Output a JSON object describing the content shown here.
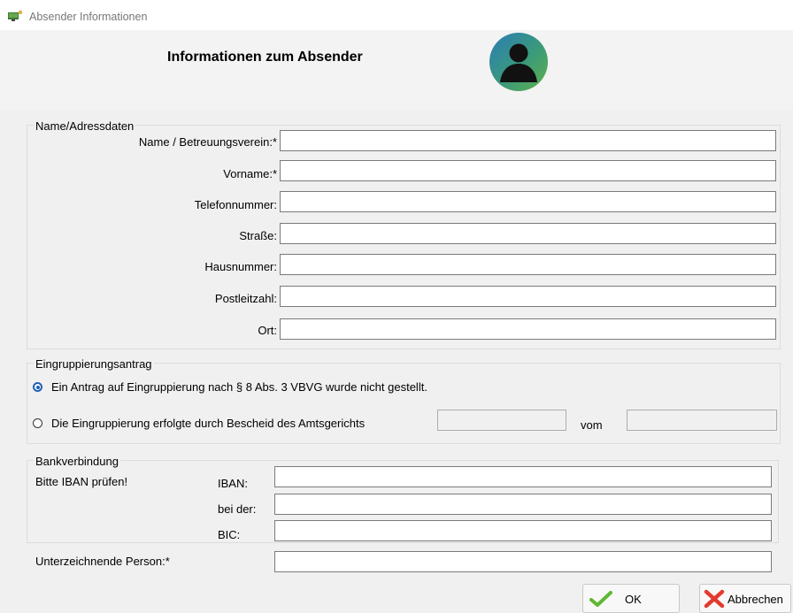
{
  "window": {
    "title": "Absender Informationen"
  },
  "header": {
    "heading": "Informationen zum Absender",
    "avatar_icon": "user-avatar-icon"
  },
  "address": {
    "legend": "Name/Adressdaten",
    "name_label": "Name / Betreuungsverein:*",
    "name_value": "",
    "firstname_label": "Vorname:*",
    "firstname_value": "",
    "phone_label": "Telefonnummer:",
    "phone_value": "",
    "street_label": "Straße:",
    "street_value": "",
    "housenr_label": "Hausnummer:",
    "housenr_value": "",
    "zip_label": "Postleitzahl:",
    "zip_value": "",
    "city_label": "Ort:",
    "city_value": ""
  },
  "grouping": {
    "legend": "Eingruppierungsantrag",
    "option1_label": "Ein Antrag auf Eingruppierung nach § 8 Abs. 3 VBVG wurde nicht gestellt.",
    "option1_selected": true,
    "option2_label": "Die Eingruppierung erfolgte durch Bescheid des Amtsgerichts",
    "option2_selected": false,
    "court_value": "",
    "vom_label": "vom",
    "date_value": ""
  },
  "bank": {
    "legend": "Bankverbindung",
    "hint": "Bitte IBAN prüfen!",
    "iban_label": "IBAN:",
    "iban_value": "",
    "bank_label": "bei der:",
    "bank_value": "",
    "bic_label": "BIC:",
    "bic_value": ""
  },
  "signer": {
    "label": "Unterzeichnende Person:*",
    "value": ""
  },
  "buttons": {
    "ok_label": "OK",
    "ok_icon": "checkmark-icon",
    "cancel_label": "Abbrechen",
    "cancel_icon": "x-icon"
  },
  "colors": {
    "radio_selected": "#1f5fb6",
    "ok_check": "#5fb832",
    "cancel_x": "#e23a2e"
  }
}
